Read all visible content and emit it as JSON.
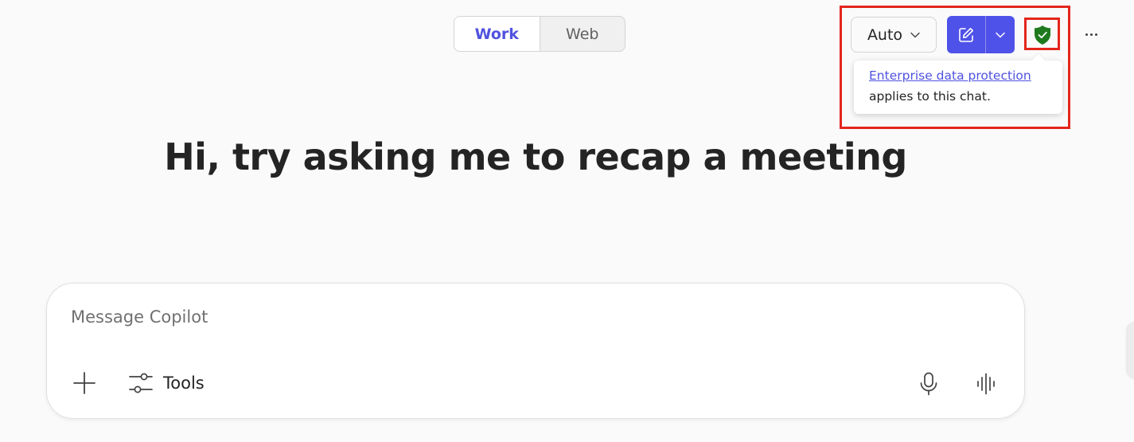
{
  "mode_toggle": {
    "work_label": "Work",
    "web_label": "Web",
    "selected": "Work"
  },
  "model_selector": {
    "label": "Auto"
  },
  "new_chat": {
    "has_dropdown": true
  },
  "protection": {
    "icon": "shield-check-icon",
    "tooltip_link": "Enterprise data protection",
    "tooltip_text": "applies to this chat."
  },
  "more_icon": "more-horizontal-icon",
  "greeting": "Hi, try asking me to recap a meeting",
  "composer": {
    "placeholder": "Message Copilot",
    "value": "",
    "tools_label": "Tools"
  },
  "colors": {
    "accent": "#4f52e8",
    "shield": "#1e7a1e",
    "highlight": "#e3261c",
    "background": "#fafafa"
  }
}
